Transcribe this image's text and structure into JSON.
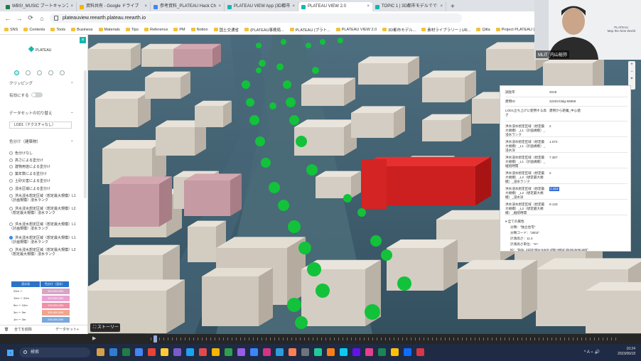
{
  "browser": {
    "tabs": [
      {
        "label": "WBS!_MUSIC ブートキャンプ.xlsx - ...",
        "color": "#1e7e45"
      },
      {
        "label": "資料共有 - Google ドライブ",
        "color": "#f4b400"
      },
      {
        "label": "参考資料_PLATEAU Hack Challe...",
        "color": "#4285f4"
      },
      {
        "label": "PLATEAU VIEW App (3D都市モ...",
        "color": "#16b6b0"
      },
      {
        "label": "PLATEAU VIEW 2.0",
        "color": "#16b6b0",
        "active": true
      },
      {
        "label": "TOPIC 1 | 3D都市モデルでできる...",
        "color": "#16b6b0"
      }
    ],
    "new_tab": "+",
    "url": "plateauview.reearth.plateau.reearth.io",
    "nav": {
      "back": "←",
      "forward": "→",
      "reload": "⟳",
      "home": "⌂"
    },
    "bookmarks": [
      "SNS",
      "Contents",
      "Tools",
      "Business",
      "Materials",
      "Tips",
      "Reference",
      "PM",
      "Notion",
      "国土交通省",
      "(PLATEAU事務局...",
      "PLATEAU (プラト...",
      "PLATEAU VIEW 2.0",
      "3D都市モデル...",
      "素材ライブラリー | UR...",
      "Qiita",
      "Project PLATEAU (P..."
    ]
  },
  "panel": {
    "close": "×",
    "logo": "PLATEAU",
    "section_clipping": "クリッピング",
    "toggle_label": "有効にする",
    "section_dataset_switch": "データセットの切り替え",
    "select_value": "LOD1（テクスチャなし）",
    "section_color": "色分け（建築物）",
    "options": [
      "色分けなし",
      "高さによる塗分け",
      "建物用途による塗分け",
      "築年数による塗分け",
      "土砂災害による塗分け",
      "浸水区域による塗分け",
      "洪水浸水想定区域（想定最大規模）L1（計画規模）浸水ランク",
      "洪水浸水想定区域（想定最大規模）L2（想定最大規模）浸水ランク",
      "洪水浸水想定区域（想定最大規模）L1（計画規模）浸水ランク",
      "洪水浸水想定区域（想定最大規模）L1（計画規模）浸水ランク",
      "洪水浸水想定区域（想定最大規模）L2（想定最大規模）浸水ランク"
    ],
    "selected_option_index": 9,
    "legend": {
      "head": [
        "浸水深",
        "色分け（浸水）"
      ],
      "rows": [
        {
          "label": "20m ー",
          "value": "500,000,000",
          "color": "#d7a4c4"
        },
        {
          "label": "10m ー 20m",
          "value": "300,000,000",
          "color": "#e7a3d2"
        },
        {
          "label": "5m ー 10m",
          "value": "100,000,000",
          "color": "#f08fa5"
        },
        {
          "label": "3m ー 5m",
          "value": "300,000,000",
          "color": "#f0a590"
        },
        {
          "label": "1m ー 3m",
          "value": "200,000,000",
          "color": "#7ba8dc"
        }
      ]
    },
    "footer_left": "全てを削除",
    "footer_right": "データセット+"
  },
  "map": {
    "story_button": "ストーリー",
    "zoom": [
      "+",
      "−",
      "⌖"
    ]
  },
  "popup": {
    "rows": [
      {
        "k": "調査年",
        "v": "2018"
      },
      {
        "k": "建物ID",
        "v": "22203-bldg-56559"
      },
      {
        "k": "LOD1立ち上げに使用する高さ",
        "v": "建物から距離_中心値"
      },
      {
        "k": "洪水浸水想定区域（想定最大規模）_L1（計画規模）_浸水ランク",
        "v": "2"
      },
      {
        "k": "洪水浸水想定区域（想定最大規模）_L1（計画規模）_浸水深",
        "v": "1.072"
      },
      {
        "k": "洪水浸水想定区域（想定最大規模）_L1（計画規模）_継続時間",
        "v": "7.367"
      },
      {
        "k": "洪水浸水想定区域（想定最大規模）_L2（想定最大規模）_浸水ランク",
        "v": "2"
      },
      {
        "k": "洪水浸水想定区域（想定最大規模）_L2（想定最大規模）_浸水深",
        "v": "2.363",
        "highlight": true
      },
      {
        "k": "洪水浸水想定区域（想定最大規模）_L2（想定最大規模）_継続時間",
        "v": "9.133"
      }
    ],
    "tree": [
      "▾ 全ての属性",
      "分類：\"独立住宅\"",
      "分類コード：\"3002\"",
      "計測高さ：11.4",
      "計測高さ単位：\"m\"",
      "ID：\"bldg_2d4b78be-64e0-4f9b-99bd-3b45c8e9ca5b\""
    ]
  },
  "webcam": {
    "name": "MLIT_内山裕弥",
    "brand_line1": "PLATEAU",
    "brand_line2": "Map the New World"
  },
  "taskbar": {
    "search": "検索",
    "time": "10:24",
    "date": "2023/06/18",
    "tray": "^ A ⌁ 🔊",
    "app_colors": [
      "#d6a04a",
      "#2f7dd1",
      "#1e7e45",
      "#4285f4",
      "#ea4335",
      "#ffcc33",
      "#7a5cc8",
      "#1da1f2",
      "#e24a4a",
      "#f4b400",
      "#2fa04a",
      "#9b5de5",
      "#3a86ff",
      "#d63384",
      "#2d9cdb",
      "#ff7f50",
      "#6c757d",
      "#20c997",
      "#fd7e14",
      "#0dcaf0",
      "#6610f2",
      "#e83e8c",
      "#198754",
      "#ffc107",
      "#0d6efd",
      "#dc3545"
    ]
  }
}
